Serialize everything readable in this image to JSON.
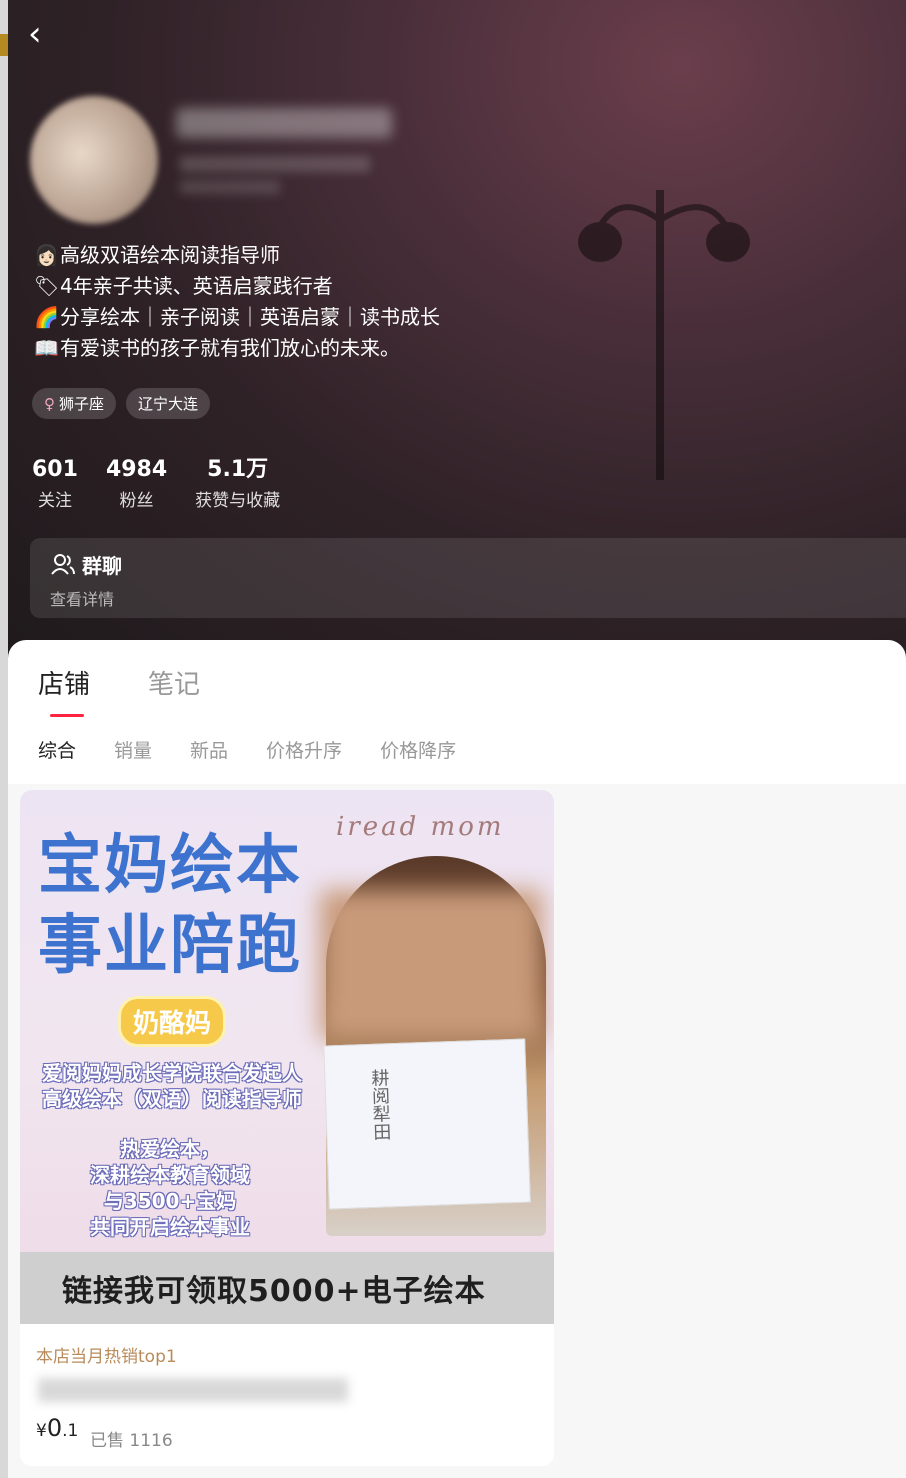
{
  "profile": {
    "bio": [
      {
        "icon": "woman-emoji",
        "glyph": "👩🏻",
        "text": "高级双语绘本阅读指导师"
      },
      {
        "icon": "label-emoji",
        "glyph": "🏷",
        "text": "4年亲子共读、英语启蒙践行者"
      },
      {
        "icon": "rainbow-emoji",
        "glyph": "🌈",
        "text": "分享绘本｜亲子阅读｜英语启蒙｜读书成长"
      },
      {
        "icon": "book-emoji",
        "glyph": "📖",
        "text": "有爱读书的孩子就有我们放心的未来。"
      }
    ],
    "tags": [
      {
        "symbol": "♀",
        "label": "狮子座"
      },
      {
        "label": "辽宁大连"
      }
    ],
    "stats": [
      {
        "value": "601",
        "label": "关注"
      },
      {
        "value": "4984",
        "label": "粉丝"
      },
      {
        "value": "5.1万",
        "label": "获赞与收藏"
      }
    ],
    "group": {
      "title": "群聊",
      "subtitle": "查看详情"
    }
  },
  "tabs": [
    {
      "label": "店铺",
      "active": true
    },
    {
      "label": "笔记",
      "active": false
    }
  ],
  "sorts": [
    {
      "label": "综合",
      "active": true
    },
    {
      "label": "销量"
    },
    {
      "label": "新品"
    },
    {
      "label": "价格升序"
    },
    {
      "label": "价格降序"
    }
  ],
  "product": {
    "cover": {
      "title_line1": "宝妈绘本",
      "title_line2": "事业陪跑",
      "script": "iread mom",
      "badge": "奶酪妈",
      "line1": "爱阅妈妈成长学院联合发起人",
      "line2": "高级绘本（双语）阅读指导师",
      "line3": "热爱绘本，",
      "line4": "深耕绘本教育领域",
      "line5": "与3500+宝妈",
      "line6": "共同开启绘本事业",
      "book_text": "耕阅犁田",
      "banner": "链接我可领取5000+电子绘本"
    },
    "hot_label": "本店当月热销top1",
    "currency": "¥",
    "price_int": "0",
    "price_dec": ".1",
    "sold": "已售 1116"
  },
  "colors": {
    "accent": "#ff2442",
    "cover_title": "#3d73cf"
  }
}
